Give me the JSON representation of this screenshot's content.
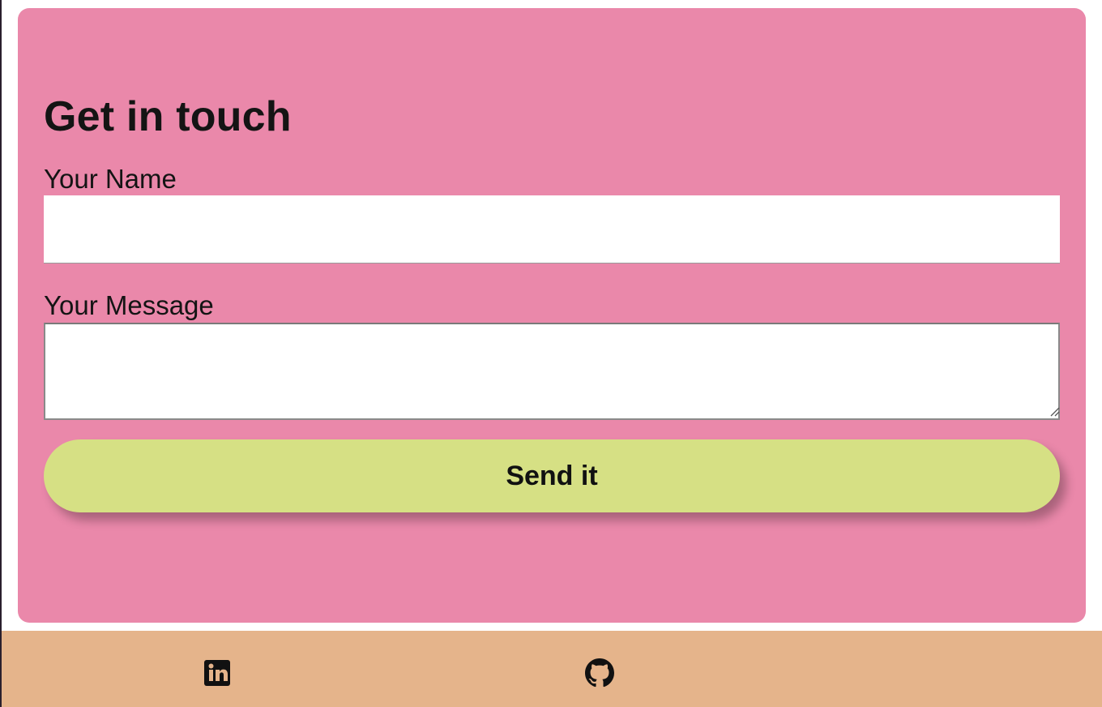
{
  "colors": {
    "card_background": "#ea88aa",
    "button_background": "#d6e084",
    "footer_background": "#e5b48b",
    "text": "#141414"
  },
  "contact": {
    "title": "Get in touch",
    "name_label": "Your Name",
    "name_value": "",
    "message_label": "Your Message",
    "message_value": "",
    "submit_label": "Send it"
  },
  "footer": {
    "links": [
      {
        "icon": "linkedin-icon"
      },
      {
        "icon": "github-icon"
      }
    ]
  }
}
